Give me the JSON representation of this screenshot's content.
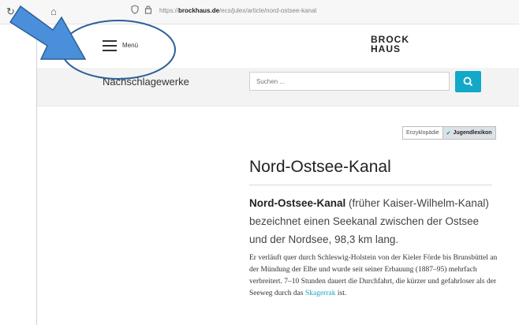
{
  "browser": {
    "url_prefix": "https://",
    "url_domain": "brockhaus.de",
    "url_path": "/ecs/julex/article/nord-ostsee-kanal"
  },
  "header": {
    "menu_label": "Menü",
    "logo_line1": "BROCK",
    "logo_line2": "HAUS"
  },
  "subbar": {
    "title": "Nachschlagewerke",
    "search_placeholder": "Suchen ..."
  },
  "toggle": {
    "option1": "Enzyklopädie",
    "option2": "Jugendlexikon"
  },
  "article": {
    "title": "Nord-Ostsee-Kanal",
    "lead_bold": "Nord-Ostsee-Kanal",
    "lead_rest": " (früher Kaiser-Wilhelm-Kanal) bezeichnet einen Seekanal zwischen der Ostsee und der Nordsee, 98,3 km lang.",
    "body_before_link": "Er verläuft quer durch Schleswig-Holstein von der Kieler Förde bis Brunsbüttel an der Mündung der Elbe und wurde seit seiner Erbauung (1887–95) mehrfach verbreitert. 7–10 Stunden dauert die Durchfahrt, die kürzer und gefahrloser als der Seeweg durch das ",
    "body_link": "Skagerrak",
    "body_after_link": " ist."
  },
  "colors": {
    "accent": "#13a8c7",
    "annotation_arrow": "#4a8fd9",
    "annotation_circle": "#2e5f99"
  },
  "icons": [
    "home-icon",
    "shield-icon",
    "lock-icon",
    "hamburger-icon",
    "search-icon",
    "checkmark-icon",
    "annotation-arrow",
    "annotation-circle"
  ]
}
